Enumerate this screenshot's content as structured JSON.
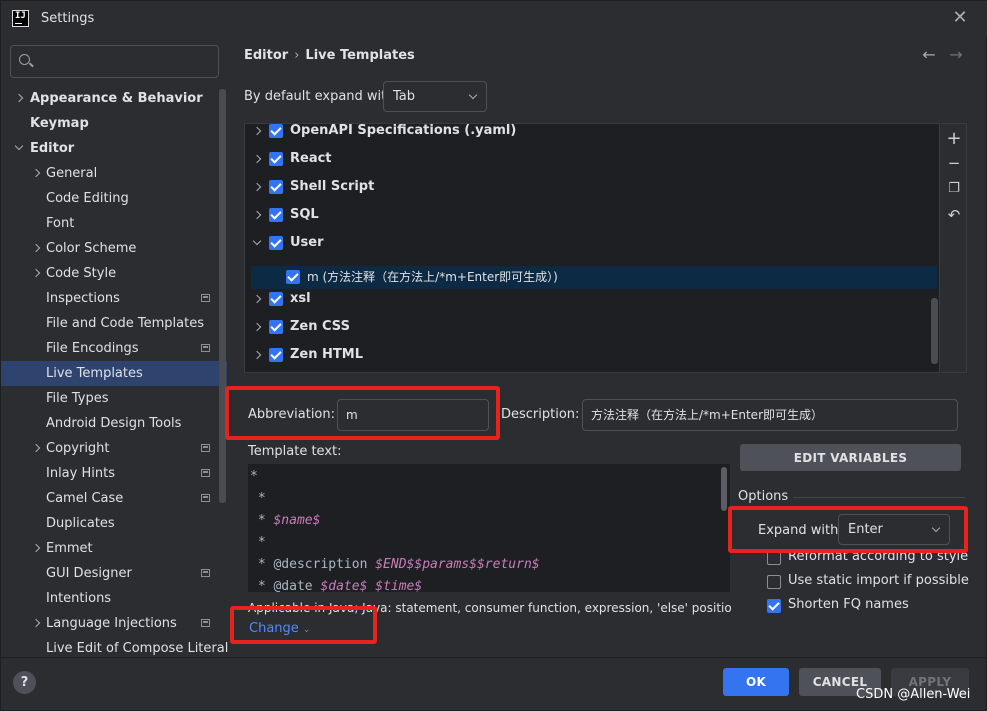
{
  "window": {
    "title": "Settings",
    "app_icon": "intellij-icon",
    "close_icon": "close-icon"
  },
  "sidebar": {
    "search_placeholder": "",
    "items": [
      {
        "label": "Appearance & Behavior",
        "level": 0,
        "bold": true,
        "expand": "collapsed"
      },
      {
        "label": "Keymap",
        "level": 0,
        "bold": true,
        "expand": "none"
      },
      {
        "label": "Editor",
        "level": 0,
        "bold": true,
        "expand": "expanded"
      },
      {
        "label": "General",
        "level": 1,
        "expand": "collapsed"
      },
      {
        "label": "Code Editing",
        "level": 1,
        "expand": "none"
      },
      {
        "label": "Font",
        "level": 1,
        "expand": "none"
      },
      {
        "label": "Color Scheme",
        "level": 1,
        "expand": "collapsed"
      },
      {
        "label": "Code Style",
        "level": 1,
        "expand": "collapsed"
      },
      {
        "label": "Inspections",
        "level": 1,
        "expand": "none",
        "project_icon": true
      },
      {
        "label": "File and Code Templates",
        "level": 1,
        "expand": "none"
      },
      {
        "label": "File Encodings",
        "level": 1,
        "expand": "none",
        "project_icon": true
      },
      {
        "label": "Live Templates",
        "level": 1,
        "expand": "none",
        "selected": true
      },
      {
        "label": "File Types",
        "level": 1,
        "expand": "none"
      },
      {
        "label": "Android Design Tools",
        "level": 1,
        "expand": "none"
      },
      {
        "label": "Copyright",
        "level": 1,
        "expand": "collapsed",
        "project_icon": true
      },
      {
        "label": "Inlay Hints",
        "level": 1,
        "expand": "none",
        "project_icon": true
      },
      {
        "label": "Camel Case",
        "level": 1,
        "expand": "none",
        "project_icon": true
      },
      {
        "label": "Duplicates",
        "level": 1,
        "expand": "none"
      },
      {
        "label": "Emmet",
        "level": 1,
        "expand": "collapsed"
      },
      {
        "label": "GUI Designer",
        "level": 1,
        "expand": "none",
        "project_icon": true
      },
      {
        "label": "Intentions",
        "level": 1,
        "expand": "none"
      },
      {
        "label": "Language Injections",
        "level": 1,
        "expand": "collapsed",
        "project_icon": true
      },
      {
        "label": "Live Edit of Compose Literal",
        "level": 1,
        "expand": "none"
      }
    ]
  },
  "header": {
    "breadcrumb_parent": "Editor",
    "breadcrumb_sep": "›",
    "breadcrumb_current": "Live Templates",
    "back_icon": "arrow-left-icon",
    "forward_icon": "arrow-right-icon"
  },
  "expand_default": {
    "label": "By default expand with",
    "value": "Tab"
  },
  "template_groups": [
    {
      "label": "OpenAPI Specifications (.yaml)",
      "checked": true,
      "expanded": false
    },
    {
      "label": "React",
      "checked": true,
      "expanded": false
    },
    {
      "label": "Shell Script",
      "checked": true,
      "expanded": false
    },
    {
      "label": "SQL",
      "checked": true,
      "expanded": false
    },
    {
      "label": "User",
      "checked": true,
      "expanded": true
    },
    {
      "label": "m (方法注释（在方法上/*m+Enter即可生成）)",
      "checked": true,
      "child": true,
      "selected": true
    },
    {
      "label": "xsl",
      "checked": true,
      "expanded": false
    },
    {
      "label": "Zen CSS",
      "checked": true,
      "expanded": false
    },
    {
      "label": "Zen HTML",
      "checked": true,
      "expanded": false
    }
  ],
  "toolbar": {
    "add_icon": "add-icon",
    "remove_icon": "minus-icon",
    "copy_icon": "copy-icon",
    "restore_icon": "undo-icon"
  },
  "abbreviation": {
    "label": "Abbreviation:",
    "value": "m"
  },
  "description": {
    "label": "Description:",
    "value": "方法注释（在方法上/*m+Enter即可生成）"
  },
  "template_text": {
    "label": "Template text:",
    "lines": [
      [
        {
          "t": "*",
          "v": false
        }
      ],
      [
        {
          "t": " *",
          "v": false
        }
      ],
      [
        {
          "t": " * ",
          "v": false
        },
        {
          "t": "$name$",
          "v": true
        }
      ],
      [
        {
          "t": " *",
          "v": false
        }
      ],
      [
        {
          "t": " * @description ",
          "v": false
        },
        {
          "t": "$END$$params$$return$",
          "v": true
        }
      ],
      [
        {
          "t": " * @date ",
          "v": false
        },
        {
          "t": "$date$ $time$",
          "v": true
        }
      ]
    ]
  },
  "applicable": {
    "text": "Applicable in Java; Java: statement, consumer function, expression, 'else' position...",
    "change_label": "Change"
  },
  "edit_variables_label": "EDIT VARIABLES",
  "options": {
    "title": "Options",
    "expand_with_label": "Expand with",
    "expand_with_value": "Enter",
    "checkboxes": [
      {
        "label": "Reformat according to style",
        "checked": false
      },
      {
        "label": "Use static import if possible",
        "checked": false
      },
      {
        "label": "Shorten FQ names",
        "checked": true
      }
    ]
  },
  "footer": {
    "help_label": "?",
    "ok_label": "OK",
    "cancel_label": "CANCEL",
    "apply_label": "APPLY"
  },
  "watermark": "CSDN @Allen-Wei",
  "colors": {
    "background": "#2b2d30",
    "selection": "#2e436e",
    "accent": "#3574f0",
    "highlight_box": "#e8231f",
    "template_variable": "#c77dbb"
  }
}
